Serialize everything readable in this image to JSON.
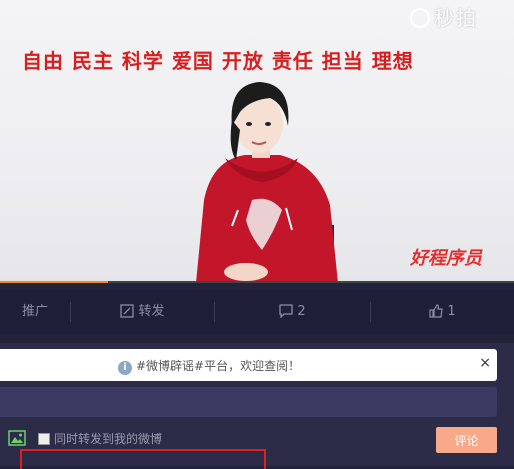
{
  "video": {
    "watermark": "秒拍",
    "slogan": "自由 民主 科学 爱国 开放 责任 担当 理想",
    "brand_logo": "好程序员",
    "progress": 0.21
  },
  "actions": {
    "promote": "推广",
    "forward": "转发",
    "comments": "2",
    "likes": "1"
  },
  "notice": {
    "text": "#微博辟谣#平台，欢迎查阅！",
    "close": "×"
  },
  "composer": {
    "checkbox_label": "同时转发到我的微博",
    "submit": "评论"
  },
  "colors": {
    "page_bg": "#22223a",
    "bar_bg": "#1f1f38",
    "accent": "#f28a1e",
    "submit": "#f7a98a",
    "slogan": "#d81e1e",
    "highlight": "#e02020"
  },
  "icons": {
    "forward": "forward-icon",
    "comment": "comment-icon",
    "like": "like-icon",
    "info": "info-icon",
    "image": "image-icon"
  }
}
